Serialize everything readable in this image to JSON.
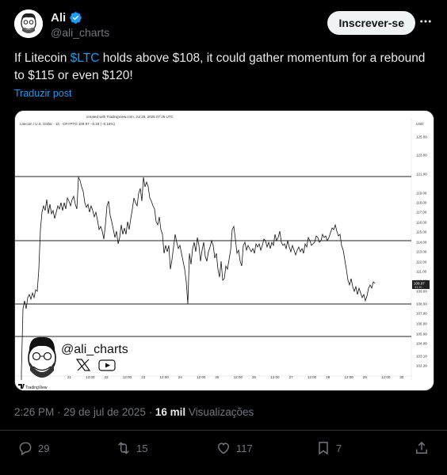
{
  "author": {
    "name": "Ali",
    "handle": "@ali_charts",
    "follow_label": "Inscrever-se"
  },
  "tweet": {
    "text_before": "If Litecoin ",
    "cashtag": "$LTC",
    "text_after": " holds above $108, it could gather momentum for a rebound to $115 or even $120!",
    "translate_label": "Traduzir post"
  },
  "chart": {
    "created_with": "created with TradingView.com, Jul 29, 2025 07:26 UTC",
    "symbol_line": "Litecoin / U.S. Dollar · 1h · CRYPTO  109.97  −0.18 (−0.16%)",
    "currency": "USD",
    "price_labels": [
      "125.00",
      "123.00",
      "121.00",
      "119.00",
      "118.00",
      "117.00",
      "116.00",
      "115.00",
      "114.00",
      "113.00",
      "112.00",
      "111.00",
      "110.00",
      "109.00",
      "108.00",
      "107.00",
      "106.00",
      "105.00",
      "104.00",
      "103.10",
      "102.20"
    ],
    "last_price": "109.97",
    "last_time": "33:30",
    "time_labels": [
      "21",
      "12:00",
      "22",
      "12:00",
      "23",
      "12:00",
      "24",
      "12:00",
      "25",
      "12:00",
      "26",
      "12:00",
      "27",
      "12:00",
      "28",
      "12:00",
      "29",
      "12:00",
      "30"
    ],
    "watermark_handle": "@ali_charts",
    "tradingview_logo": "TradingView"
  },
  "meta": {
    "time": "2:26 PM",
    "separator": " · ",
    "date": "29 de jul de 2025",
    "dot": " · ",
    "views_count": "16 mil",
    "views_label": "Visualizações"
  },
  "stats": {
    "replies": "29",
    "reposts": "15",
    "likes": "117",
    "bookmarks": "7"
  },
  "colors": {
    "accent": "#1d9bf0",
    "background": "#000000",
    "muted": "#71767b"
  }
}
